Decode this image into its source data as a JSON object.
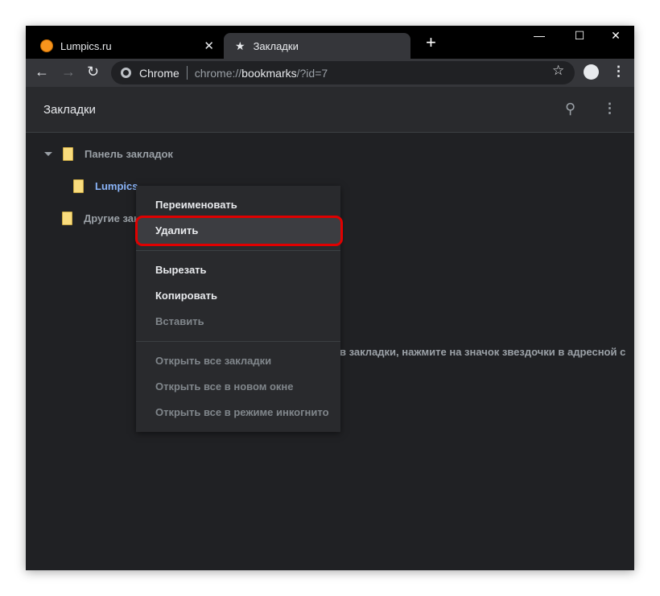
{
  "tabs": [
    {
      "title": "Lumpics.ru",
      "close": "✕"
    },
    {
      "title": "Закладки"
    }
  ],
  "new_tab": "+",
  "window_controls": {
    "minimize": "—",
    "maximize": "☐",
    "close": "✕"
  },
  "omnibox": {
    "site": "Chrome",
    "url_prefix": "chrome://",
    "url_host": "bookmarks",
    "url_rest": "/?id=7"
  },
  "page": {
    "title": "Закладки"
  },
  "tree": [
    {
      "label": "Панель закладок"
    },
    {
      "label": "Lumpics"
    },
    {
      "label": "Другие зак"
    }
  ],
  "empty_text": "в закладки, нажмите на значок звездочки в адресной с",
  "menu": {
    "rename": "Переименовать",
    "delete": "Удалить",
    "cut": "Вырезать",
    "copy": "Копировать",
    "paste": "Вставить",
    "open_all": "Открыть все закладки",
    "open_new_window": "Открыть все в новом окне",
    "open_incognito": "Открыть все в режиме инкогнито"
  },
  "colors": {
    "highlight": "#e00000",
    "selected": "#8ab4f8"
  }
}
